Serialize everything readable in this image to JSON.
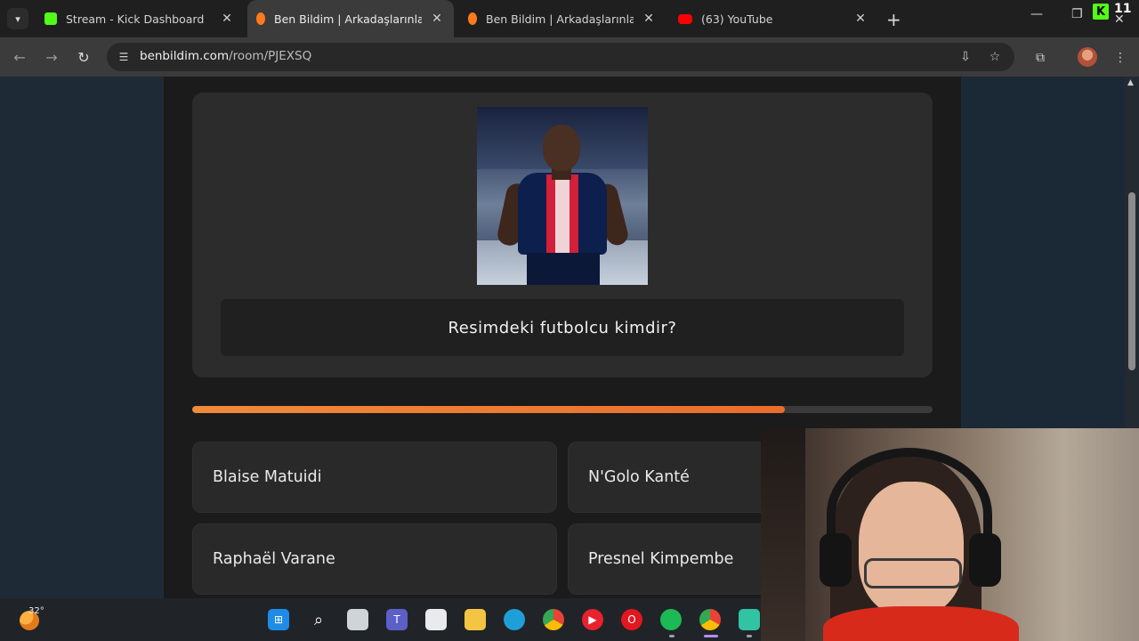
{
  "browser": {
    "tabs": [
      {
        "title": "Stream - Kick Dashboard",
        "favicon": "kick-icon",
        "active": false
      },
      {
        "title": "Ben Bildim | Arkadaşlarınla Onli",
        "favicon": "benbildim-icon",
        "active": true
      },
      {
        "title": "Ben Bildim | Arkadaşlarınla Onli",
        "favicon": "benbildim-icon",
        "active": false
      },
      {
        "title": "(63) YouTube",
        "favicon": "youtube-icon",
        "active": false
      }
    ],
    "kick_notification_count": "11",
    "url_host": "benbildim.com",
    "url_path": "/room/PJEXSQ"
  },
  "quiz": {
    "question": "Resimdeki futbolcu kimdir?",
    "progress_fraction": 0.8,
    "answers": [
      "Blaise Matuidi",
      "N'Golo Kanté",
      "Raphaël Varane",
      "Presnel Kimpembe"
    ]
  },
  "taskbar": {
    "temperature": "32°",
    "apps": [
      "windows-start-icon",
      "search-icon",
      "task-view-icon",
      "teams-icon",
      "store-icon",
      "file-explorer-icon",
      "edge-icon",
      "chrome-icon",
      "youtube-music-icon",
      "opera-icon",
      "spotify-icon",
      "chrome-profile-icon",
      "streamlabs-icon"
    ]
  },
  "colors": {
    "accent_orange": "#ea6d2c",
    "card_bg": "#2c2c2c",
    "page_bg": "#1b1b1b"
  }
}
